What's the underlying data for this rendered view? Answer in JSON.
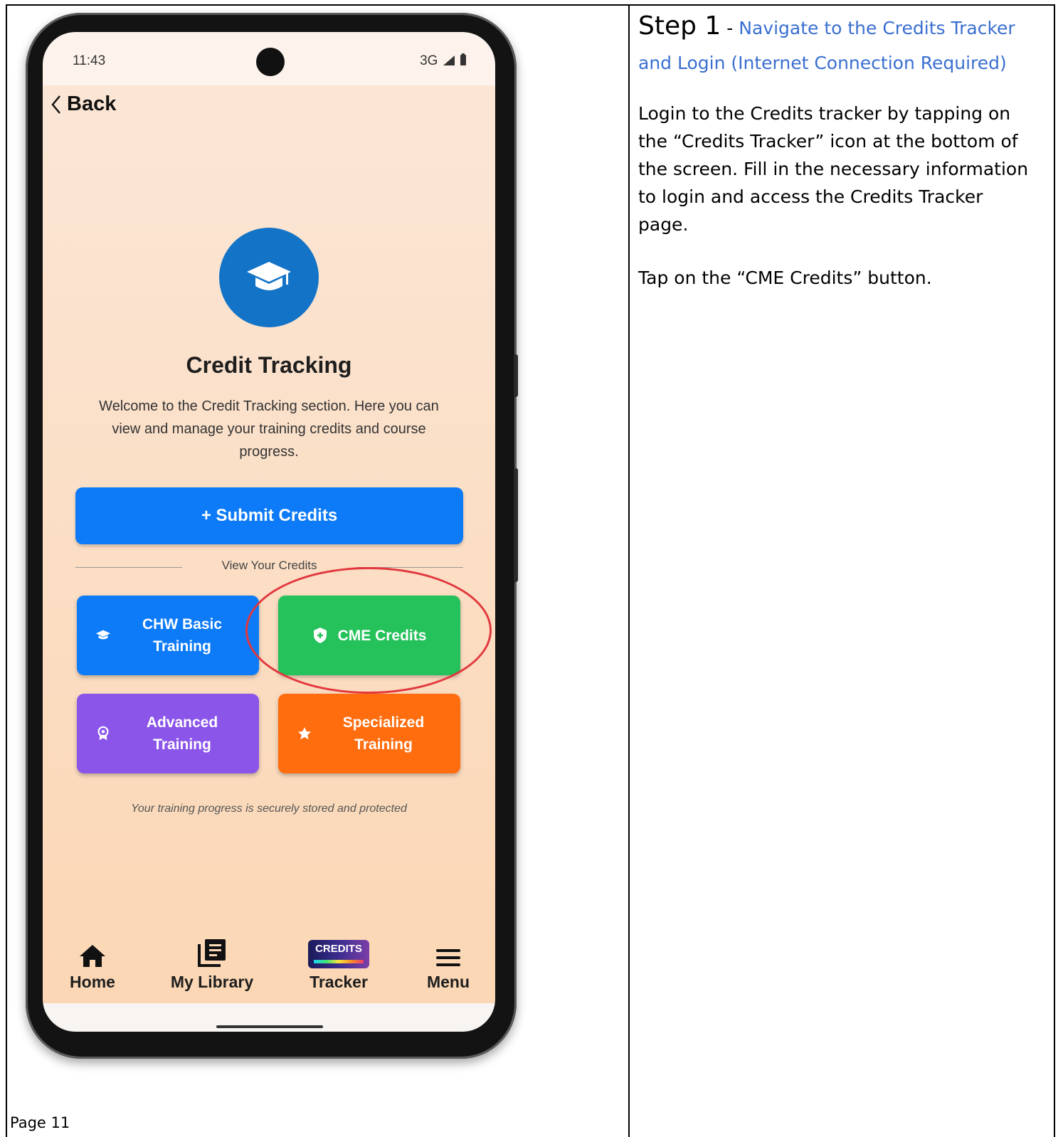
{
  "phone": {
    "status_time": "11:43",
    "status_network": "3G",
    "back_label": "Back",
    "title": "Credit Tracking",
    "description": "Welcome to the Credit Tracking section. Here you can view and manage your training credits and course progress.",
    "submit_label": "+  Submit Credits",
    "divider_label": "View Your Credits",
    "tiles": [
      {
        "label": "CHW Basic Training",
        "color": "#0d7bf7",
        "icon": "graduation-cap-icon"
      },
      {
        "label": "CME Credits",
        "color": "#25c15b",
        "icon": "shield-plus-icon"
      },
      {
        "label": "Advanced Training",
        "color": "#8b55ea",
        "icon": "award-icon"
      },
      {
        "label": "Specialized Training",
        "color": "#ff6d0e",
        "icon": "star-icon"
      }
    ],
    "footnote": "Your training progress is securely stored and protected",
    "nav": [
      {
        "label": "Home",
        "icon": "home-icon"
      },
      {
        "label": "My Library",
        "icon": "library-icon"
      },
      {
        "label": "Tracker",
        "icon": "credits-logo",
        "logo_text": "CREDITS"
      },
      {
        "label": "Menu",
        "icon": "menu-icon"
      }
    ]
  },
  "instructions": {
    "step_title": "Step 1",
    "step_dash": " - ",
    "step_subtitle": "Navigate to the Credits Tracker and Login (Internet Connection Required)",
    "paragraph1": "Login to the Credits tracker by tapping on the “Credits Tracker” icon at the bottom of the screen. Fill in the necessary information to login and access the Credits Tracker page.",
    "paragraph2": "Tap on the “CME Credits” button."
  },
  "page_label": "Page 11"
}
